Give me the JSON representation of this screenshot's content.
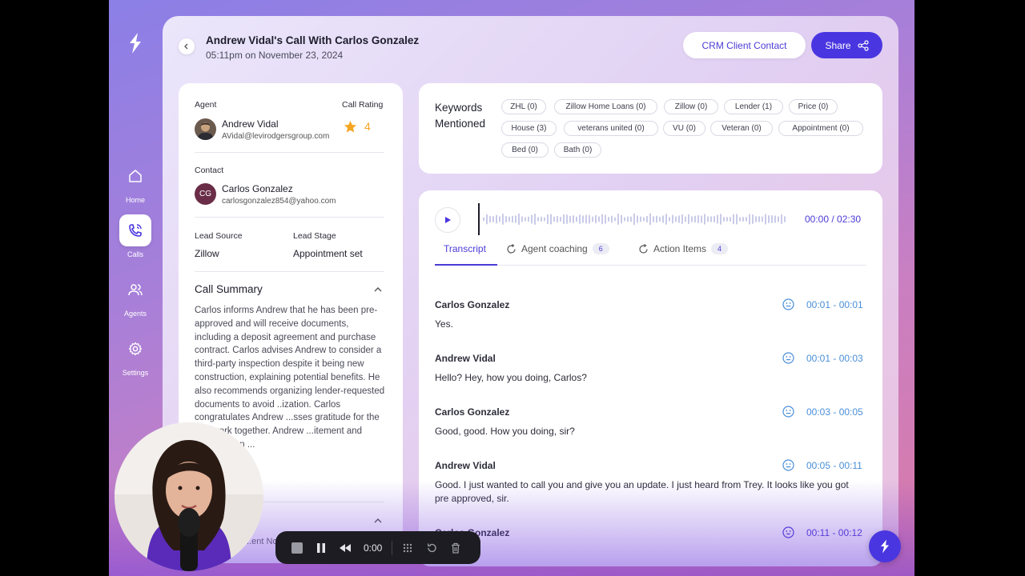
{
  "nav": {
    "items": [
      {
        "label": "Home",
        "icon": "home-icon",
        "active": false
      },
      {
        "label": "Calls",
        "icon": "phone-call-icon",
        "active": true
      },
      {
        "label": "Agents",
        "icon": "users-icon",
        "active": false
      },
      {
        "label": "Settings",
        "icon": "gear-icon",
        "active": false
      }
    ]
  },
  "header": {
    "title": "Andrew Vidal's Call With Carlos Gonzalez",
    "datetime": "05:11pm on November 23, 2024",
    "crm_label": "CRM Client Contact",
    "share_label": "Share"
  },
  "details": {
    "agent_label": "Agent",
    "rating_label": "Call Rating",
    "rating_value": "4",
    "agent_name": "Andrew Vidal",
    "agent_email": "AVidal@levirodgersgroup.com",
    "contact_label": "Contact",
    "contact_initials": "CG",
    "contact_name": "Carlos Gonzalez",
    "contact_email": "carlosgonzalez854@yahoo.com",
    "lead_source_label": "Lead Source",
    "lead_source": "Zillow",
    "lead_stage_label": "Lead Stage",
    "lead_stage": "Appointment set",
    "summary_title": "Call Summary",
    "summary_text": "Carlos informs Andrew that he has been pre-approved and will receive documents, including a deposit agreement and purchase contract. Carlos advises Andrew to consider a third-party inspection despite it being new construction, explaining potential benefits. He also recommends organizing lender-requested documents to avoid ..ization. Carlos congratulates Andrew ...sses gratitude for the ...to work together. Andrew ...itement and appreciation ...",
    "agent_notes_label": "...ent No..."
  },
  "keywords": {
    "title": "Keywords Mentioned",
    "chips": [
      "ZHL (0)",
      "Zillow Home Loans (0)",
      "Zillow (0)",
      "Lender (1)",
      "Price (0)",
      "House (3)",
      "veterans united (0)",
      "VU (0)",
      "Veteran (0)",
      "Appointment (0)",
      "Bed (0)",
      "Bath (0)"
    ]
  },
  "player": {
    "time": "00:00 / 02:30",
    "progress": 0
  },
  "tabs": [
    {
      "label": "Transcript",
      "badge": ""
    },
    {
      "label": "Agent coaching",
      "badge": "6"
    },
    {
      "label": "Action Items",
      "badge": "4"
    }
  ],
  "transcript": [
    {
      "speaker": "Carlos Gonzalez",
      "range": "00:01 - 00:01",
      "text": "Yes."
    },
    {
      "speaker": "Andrew Vidal",
      "range": "00:01 - 00:03",
      "text": "Hello? Hey, how you doing, Carlos?"
    },
    {
      "speaker": "Carlos Gonzalez",
      "range": "00:03 - 00:05",
      "text": "Good, good. How you doing, sir?"
    },
    {
      "speaker": "Andrew Vidal",
      "range": "00:05 - 00:11",
      "text": "Good. I just wanted to call you and give you an update. I just heard from Trey. It looks like you got pre approved, sir."
    },
    {
      "speaker": "Carlos Gonzalez",
      "range": "00:11 - 00:12",
      "text": ""
    }
  ],
  "recorder": {
    "time": "0:00"
  },
  "colors": {
    "accent": "#4a36e0",
    "timestamp": "#4a8fd8",
    "star": "#f5a623"
  }
}
